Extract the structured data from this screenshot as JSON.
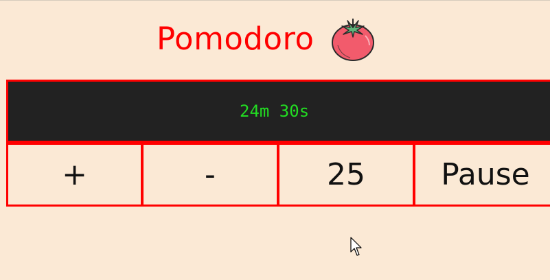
{
  "header": {
    "title": "Pomodoro",
    "icon": "tomato-icon"
  },
  "timer": {
    "display": "24m 30s"
  },
  "controls": {
    "plus_label": "+",
    "minus_label": "-",
    "minutes_value": "25",
    "pause_label": "Pause"
  },
  "colors": {
    "background": "#fbe9d5",
    "accent": "#ff0000",
    "timer_bg": "#222222",
    "timer_text": "#22dd22"
  }
}
